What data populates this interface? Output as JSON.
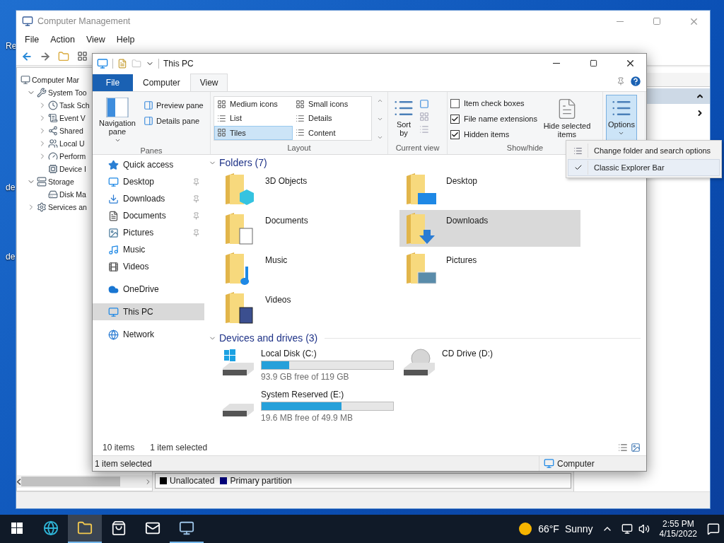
{
  "desktop_icons": [
    {
      "label": "Re"
    },
    {
      "label": "de"
    },
    {
      "label": "de"
    }
  ],
  "computer_management": {
    "title": "Computer Management",
    "menu": [
      "File",
      "Action",
      "View",
      "Help"
    ],
    "tree": [
      {
        "label": "Computer Mar",
        "kind": "computer",
        "children": [
          {
            "label": "System Too",
            "kind": "tools",
            "expanded": true,
            "children": [
              {
                "label": "Task Sch",
                "kind": "clock",
                "expanded": false
              },
              {
                "label": "Event V",
                "kind": "log",
                "expanded": false
              },
              {
                "label": "Shared",
                "kind": "share",
                "expanded": false
              },
              {
                "label": "Local U",
                "kind": "users",
                "expanded": false
              },
              {
                "label": "Perform",
                "kind": "gauge",
                "expanded": false
              },
              {
                "label": "Device I",
                "kind": "device"
              }
            ]
          },
          {
            "label": "Storage",
            "kind": "storage",
            "expanded": true,
            "children": [
              {
                "label": "Disk Ma",
                "kind": "disk"
              }
            ]
          },
          {
            "label": "Services an",
            "kind": "services",
            "expanded": false
          }
        ]
      }
    ],
    "legend": [
      {
        "label": "Unallocated",
        "color": "#000000"
      },
      {
        "label": "Primary partition",
        "color": "#000080"
      }
    ]
  },
  "explorer": {
    "title": "This PC",
    "tabs": [
      {
        "label": "File",
        "kind": "file",
        "selected": false
      },
      {
        "label": "Computer",
        "kind": "tab",
        "selected": false
      },
      {
        "label": "View",
        "kind": "tab",
        "selected": true
      }
    ],
    "panes": {
      "label": "Panes",
      "navigation": "Navigation pane",
      "items": [
        "Preview pane",
        "Details pane"
      ]
    },
    "layout": {
      "label": "Layout",
      "options": [
        {
          "label": "Medium icons",
          "selected": false
        },
        {
          "label": "Small icons",
          "selected": false
        },
        {
          "label": "List",
          "selected": false
        },
        {
          "label": "Details",
          "selected": false
        },
        {
          "label": "Tiles",
          "selected": true
        },
        {
          "label": "Content",
          "selected": false
        }
      ]
    },
    "current_view": {
      "label": "Current view",
      "sort": "Sort by"
    },
    "show_hide": {
      "label": "Show/hide",
      "checks": [
        {
          "label": "Item check boxes",
          "checked": false
        },
        {
          "label": "File name extensions",
          "checked": true
        },
        {
          "label": "Hidden items",
          "checked": true
        }
      ],
      "hide_selected": "Hide selected items"
    },
    "options_button": {
      "label": "Options",
      "pressed": true
    },
    "nav": [
      {
        "items": [
          {
            "label": "Quick access",
            "kind": "star",
            "selected": false
          },
          {
            "label": "Desktop",
            "kind": "desktop",
            "pinned": true,
            "selected": false
          },
          {
            "label": "Downloads",
            "kind": "download",
            "pinned": true,
            "selected": false
          },
          {
            "label": "Documents",
            "kind": "document",
            "pinned": true,
            "selected": false
          },
          {
            "label": "Pictures",
            "kind": "picture",
            "pinned": true,
            "selected": false
          },
          {
            "label": "Music",
            "kind": "music",
            "selected": false
          },
          {
            "label": "Videos",
            "kind": "video",
            "selected": false
          }
        ]
      },
      {
        "items": [
          {
            "label": "OneDrive",
            "kind": "cloud",
            "selected": false
          }
        ]
      },
      {
        "items": [
          {
            "label": "This PC",
            "kind": "pc",
            "selected": true
          }
        ]
      },
      {
        "items": [
          {
            "label": "Network",
            "kind": "network",
            "selected": false
          }
        ]
      }
    ],
    "folders_header": "Folders (7)",
    "folders": [
      {
        "name": "3D Objects",
        "kind": "cube",
        "selected": false
      },
      {
        "name": "Desktop",
        "kind": "desktop",
        "selected": false
      },
      {
        "name": "Documents",
        "kind": "document",
        "selected": false
      },
      {
        "name": "Downloads",
        "kind": "download",
        "selected": true
      },
      {
        "name": "Music",
        "kind": "music",
        "selected": false
      },
      {
        "name": "Pictures",
        "kind": "picture",
        "selected": false
      },
      {
        "name": "Videos",
        "kind": "video",
        "selected": false
      }
    ],
    "drives_header": "Devices and drives (3)",
    "drives": [
      {
        "name": "Local Disk (C:)",
        "kind": "system",
        "level": 0.21,
        "free": "93.9 GB free of 119 GB"
      },
      {
        "name": "CD Drive (D:)",
        "kind": "cd"
      },
      {
        "name": "System Reserved (E:)",
        "kind": "disk",
        "level": 0.61,
        "free": "19.6 MB free of 49.9 MB"
      }
    ],
    "item_count": "10 items",
    "selection_count": "1 item selected",
    "status": "1 item selected",
    "status_location": "Computer"
  },
  "options_menu": [
    {
      "label": "Change folder and search options",
      "checked": false
    },
    {
      "label": "Classic Explorer Bar",
      "checked": true
    }
  ],
  "taskbar": {
    "apps": [
      {
        "kind": "edge",
        "active": false,
        "running": false
      },
      {
        "kind": "explorer",
        "active": true,
        "running": true
      },
      {
        "kind": "store",
        "active": false,
        "running": false
      },
      {
        "kind": "mail",
        "active": false,
        "running": false
      },
      {
        "kind": "manager",
        "active": false,
        "running": true
      }
    ],
    "temperature": "66°F",
    "condition": "Sunny",
    "time": "2:55 PM",
    "date": "4/15/2022"
  }
}
